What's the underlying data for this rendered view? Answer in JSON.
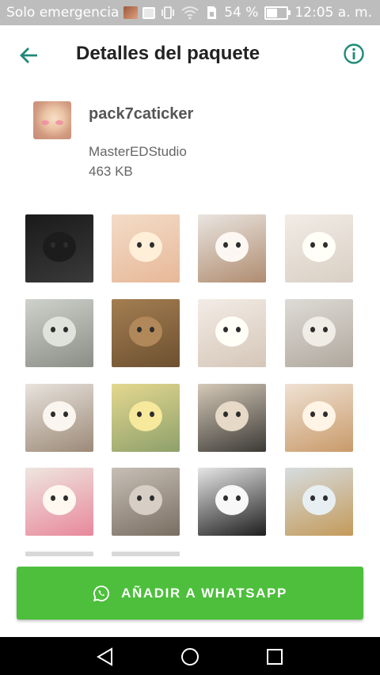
{
  "status_bar": {
    "carrier": "Solo emergencia",
    "battery": "54 %",
    "time": "12:05 a. m."
  },
  "header": {
    "title": "Detalles del paquete",
    "back_icon": "arrow-left-icon",
    "info_icon": "info-icon"
  },
  "pack": {
    "name": "pack7caticker",
    "publisher": "MasterEDStudio",
    "size": "463 KB"
  },
  "stickers": [
    {
      "id": "sticker-1",
      "colors": [
        "#1a1a1a",
        "#3a3a3a"
      ]
    },
    {
      "id": "sticker-2",
      "colors": [
        "#f3dcc8",
        "#e7b898"
      ]
    },
    {
      "id": "sticker-3",
      "colors": [
        "#e9e5e0",
        "#b08c70"
      ]
    },
    {
      "id": "sticker-4",
      "colors": [
        "#f2ece6",
        "#d9cfc4"
      ]
    },
    {
      "id": "sticker-5",
      "colors": [
        "#cfd2cc",
        "#8a8e86"
      ]
    },
    {
      "id": "sticker-6",
      "colors": [
        "#a47e52",
        "#6d5030"
      ]
    },
    {
      "id": "sticker-7",
      "colors": [
        "#f3ece6",
        "#d5c6b8"
      ]
    },
    {
      "id": "sticker-8",
      "colors": [
        "#dedbd6",
        "#b0a89e"
      ]
    },
    {
      "id": "sticker-9",
      "colors": [
        "#e8e3dd",
        "#9c8a78"
      ]
    },
    {
      "id": "sticker-10",
      "colors": [
        "#e4d890",
        "#8ea06a"
      ]
    },
    {
      "id": "sticker-11",
      "colors": [
        "#d5c9b8",
        "#3c3a36"
      ]
    },
    {
      "id": "sticker-12",
      "colors": [
        "#efe2d4",
        "#c99a6a"
      ]
    },
    {
      "id": "sticker-13",
      "colors": [
        "#eee6df",
        "#e8889c"
      ]
    },
    {
      "id": "sticker-14",
      "colors": [
        "#c7bfb6",
        "#7a6e62"
      ]
    },
    {
      "id": "sticker-15",
      "colors": [
        "#e6e6e6",
        "#1e1e1e"
      ]
    },
    {
      "id": "sticker-16",
      "colors": [
        "#d6dde0",
        "#c49a5a"
      ]
    }
  ],
  "add_button": {
    "label": "AÑADIR A WHATSAPP",
    "icon": "whatsapp-icon",
    "color": "#4dbf3c"
  },
  "nav": {
    "back": "triangle-back-icon",
    "home": "circle-home-icon",
    "recents": "square-recents-icon"
  },
  "colors": {
    "accent": "#1f8a78",
    "status_bar": "#bdbdbd"
  }
}
